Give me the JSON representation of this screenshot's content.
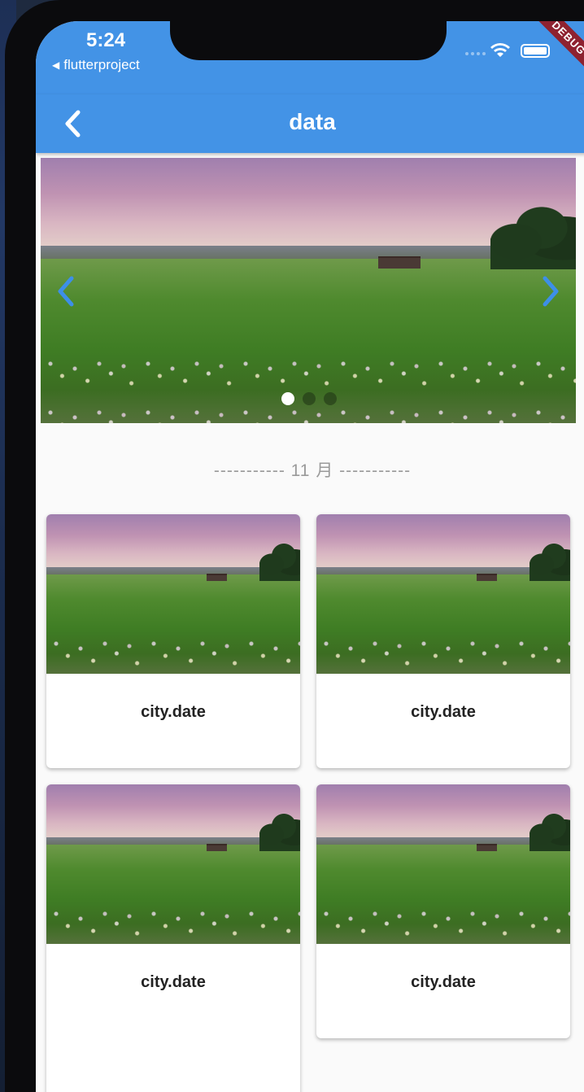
{
  "status_bar": {
    "time": "5:24",
    "back_app_label": "flutterproject",
    "debug_banner": "DEBUG"
  },
  "app_bar": {
    "title": "data",
    "back_icon": "chevron-left-icon"
  },
  "carousel": {
    "prev_icon": "chevron-left-icon",
    "next_icon": "chevron-right-icon",
    "active_index": 0,
    "page_count": 3,
    "image_alt": "field-landscape"
  },
  "section": {
    "divider_label": "----------- 11 月 -----------"
  },
  "cards": [
    {
      "caption": "city.date"
    },
    {
      "caption": "city.date"
    },
    {
      "caption": "city.date"
    },
    {
      "caption": "city.date"
    }
  ],
  "colors": {
    "primary": "#4393e6",
    "background": "#fafafa",
    "debug": "#8e2230"
  }
}
